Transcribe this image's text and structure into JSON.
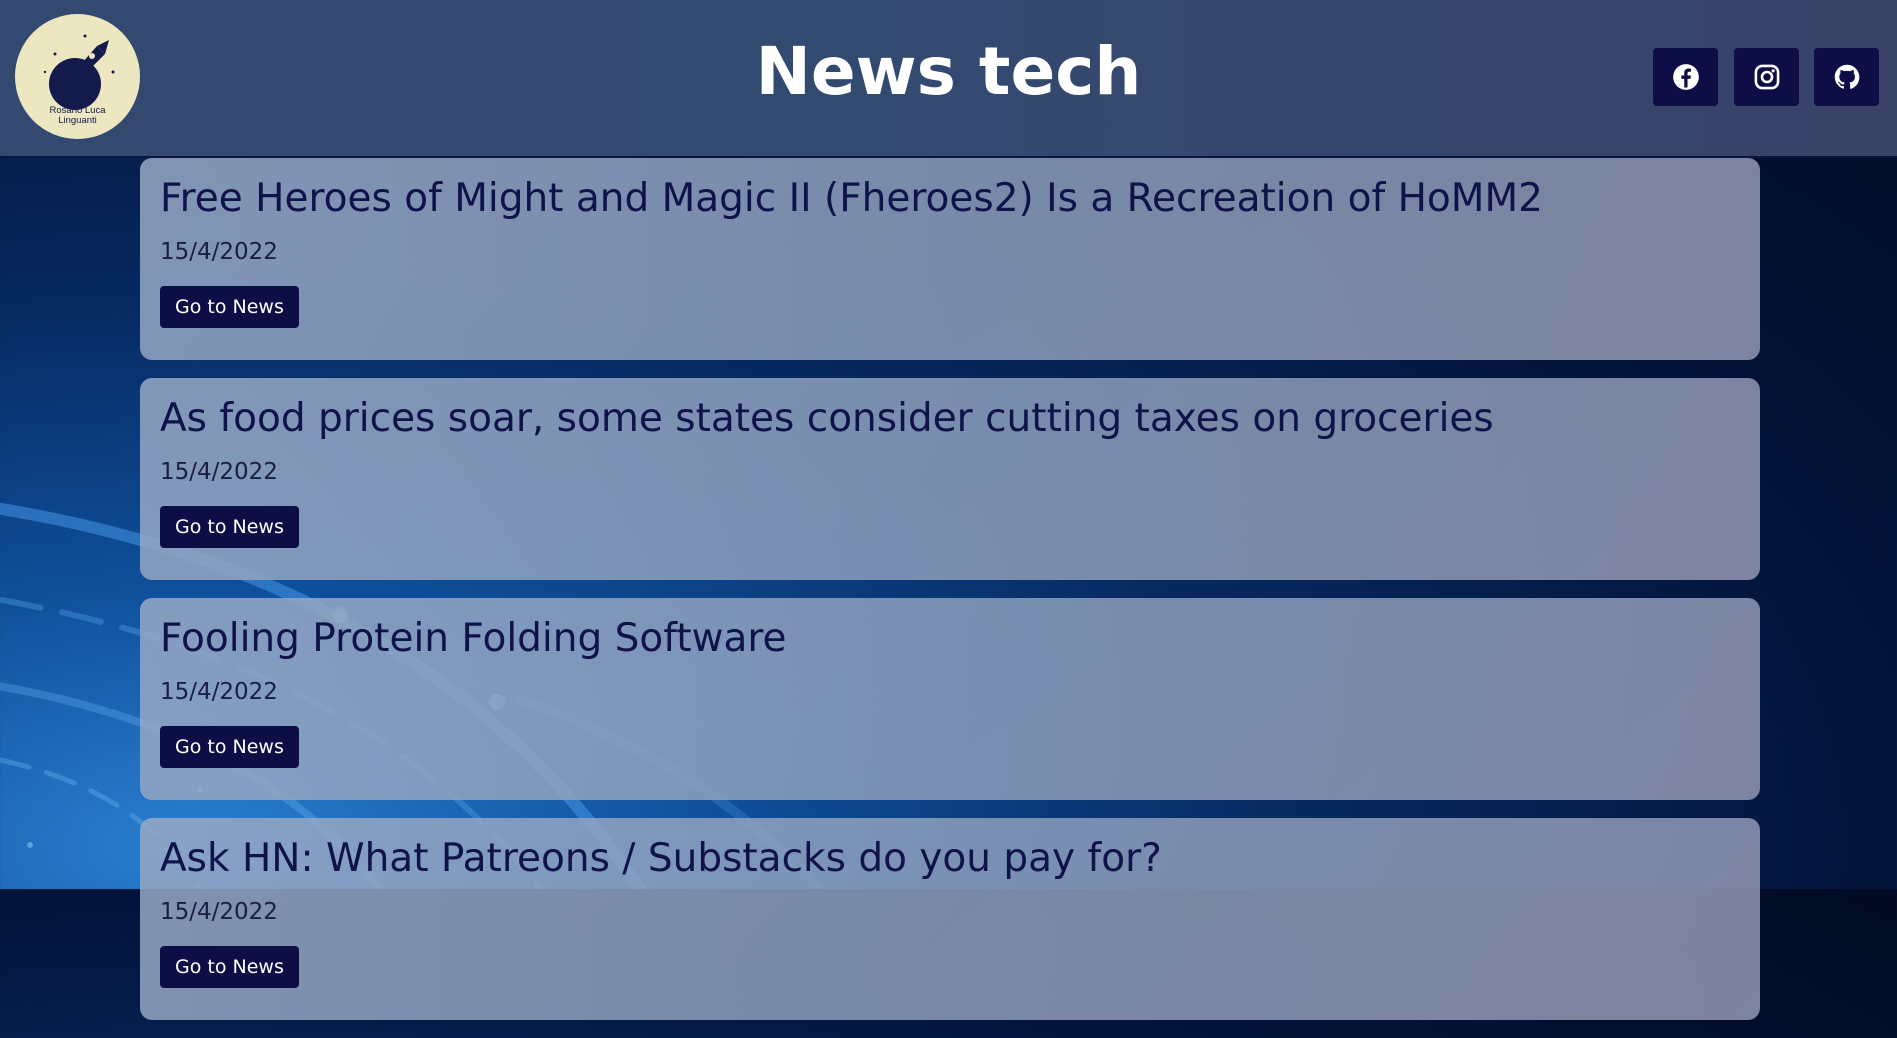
{
  "header": {
    "title": "News tech",
    "logo": {
      "text_line1": "Rosario Luca",
      "text_line2": "Linguanti",
      "icon": "rocket-icon",
      "background_color": "#ede7c1"
    },
    "social": [
      {
        "name": "Facebook",
        "icon": "facebook-icon"
      },
      {
        "name": "Instagram",
        "icon": "instagram-icon"
      },
      {
        "name": "GitHub",
        "icon": "github-icon"
      }
    ]
  },
  "news": [
    {
      "title": "Free Heroes of Might and Magic II (Fheroes2) Is a Recreation of HoMM2",
      "date": "15/4/2022",
      "button": "Go to News"
    },
    {
      "title": "As food prices soar, some states consider cutting taxes on groceries",
      "date": "15/4/2022",
      "button": "Go to News"
    },
    {
      "title": "Fooling Protein Folding Software",
      "date": "15/4/2022",
      "button": "Go to News"
    },
    {
      "title": "Ask HN: What Patreons / Substacks do you pay for?",
      "date": "15/4/2022",
      "button": "Go to News"
    }
  ],
  "colors": {
    "header_bg": "#34496f",
    "button_bg": "#0e0e47",
    "title_text": "#10134a",
    "page_bg": "#03143a"
  }
}
